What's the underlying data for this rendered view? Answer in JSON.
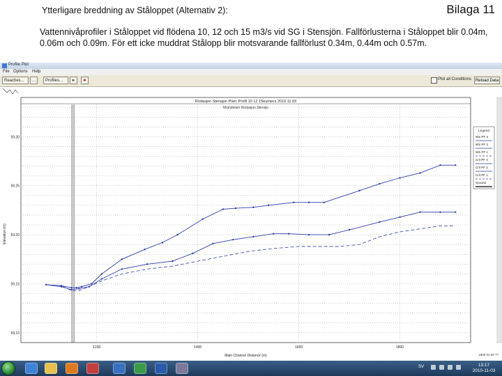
{
  "document": {
    "title": "Ytterligare breddning av Ståloppet (Alternativ 2):",
    "bilaga": "Bilaga 11",
    "description": "Vattennivåprofiler i Ståloppet vid flödena 10, 12 och 15 m3/s vid SG i Stensjön. Fallförlusterna i Ståloppet blir 0.04m, 0.06m och 0.09m. För ett icke muddrat Stålopp blir motsvarande fallförlust 0.34m, 0.44m och 0.57m."
  },
  "window": {
    "title": "Profile Plot",
    "menu": [
      "File",
      "Options",
      "Help"
    ],
    "toolbar": {
      "reaches_label": "Reaches...",
      "profiles_label": "Profiles...",
      "plot_all_label": "Plot all Conditions",
      "reload_label": "Reload Data"
    }
  },
  "chart_data": {
    "type": "line",
    "title": "Rodasjon Stensjon       Plan: Profil 10 12 15eumecs   2010 11 03",
    "subtitle": "Moindeiam Rodasjon Stensjo",
    "xlabel": "Main Channel Distance (m)",
    "ylabel": "Elevation (m)",
    "xlim": [
      1050,
      1940
    ],
    "ylim": [
      59.09,
      59.34
    ],
    "xticks": [
      1200,
      1400,
      1600,
      1800
    ],
    "yticks": [
      {
        "v": 59.3,
        "label": "59.30"
      },
      {
        "v": 59.25,
        "label": "59.25"
      },
      {
        "v": 59.2,
        "label": "59.20"
      },
      {
        "v": 59.15,
        "label": "59.15"
      },
      {
        "v": 59.1,
        "label": "59.10"
      }
    ],
    "vlines": [
      1151,
      1155
    ],
    "grid": true,
    "legend": {
      "title": "Legend",
      "position": "right",
      "entries": [
        {
          "label": "WS PF 3",
          "style": "line"
        },
        {
          "label": "WS PF 2",
          "style": "dot"
        },
        {
          "label": "WS PF 1",
          "style": "dash"
        },
        {
          "label": "Crit PF 3",
          "style": "line"
        },
        {
          "label": "Crit PF 2",
          "style": "dot"
        },
        {
          "label": "Crit PF 1",
          "style": "dash"
        },
        {
          "label": "Ground",
          "style": "ground"
        }
      ]
    },
    "corner_label": "1900 01 00 ??",
    "series": [
      {
        "name": "WS PF 3",
        "color": "#2e3ea8",
        "marker": true,
        "dash": "",
        "x": [
          1100,
          1130,
          1150,
          1160,
          1170,
          1190,
          1210,
          1250,
          1295,
          1330,
          1360,
          1410,
          1450,
          1475,
          1510,
          1540,
          1590,
          1620,
          1650,
          1720,
          1760,
          1800,
          1840,
          1880,
          1910
        ],
        "y": [
          59.149,
          59.148,
          59.146,
          59.146,
          59.147,
          59.15,
          59.16,
          59.175,
          59.185,
          59.192,
          59.2,
          59.216,
          59.226,
          59.227,
          59.228,
          59.23,
          59.233,
          59.233,
          59.233,
          59.245,
          59.252,
          59.258,
          59.263,
          59.271,
          59.271
        ]
      },
      {
        "name": "WS PF 2",
        "color": "#2e3ea8",
        "marker": true,
        "dash": "",
        "x": [
          1100,
          1130,
          1150,
          1165,
          1185,
          1210,
          1250,
          1300,
          1350,
          1390,
          1430,
          1470,
          1510,
          1550,
          1580,
          1620,
          1660,
          1700,
          1760,
          1800,
          1840,
          1880,
          1910
        ],
        "y": [
          59.149,
          59.147,
          59.144,
          59.145,
          59.147,
          59.155,
          59.165,
          59.17,
          59.173,
          59.181,
          59.191,
          59.195,
          59.198,
          59.201,
          59.201,
          59.2,
          59.2,
          59.205,
          59.213,
          59.218,
          59.223,
          59.223,
          59.223
        ]
      },
      {
        "name": "WS PF 1",
        "color": "#4a4fb0",
        "marker": false,
        "dash": "5,3",
        "x": [
          1100,
          1130,
          1150,
          1165,
          1185,
          1210,
          1250,
          1300,
          1350,
          1400,
          1450,
          1500,
          1550,
          1600,
          1640,
          1680,
          1720,
          1760,
          1800,
          1840,
          1880,
          1905
        ],
        "y": [
          59.149,
          59.148,
          59.143,
          59.143,
          59.147,
          59.153,
          59.16,
          59.165,
          59.168,
          59.173,
          59.178,
          59.183,
          59.186,
          59.188,
          59.188,
          59.188,
          59.19,
          59.198,
          59.203,
          59.206,
          59.209,
          59.209
        ]
      }
    ]
  },
  "taskbar": {
    "language": "SV",
    "time": "13:17",
    "date": "2010-11-03"
  }
}
